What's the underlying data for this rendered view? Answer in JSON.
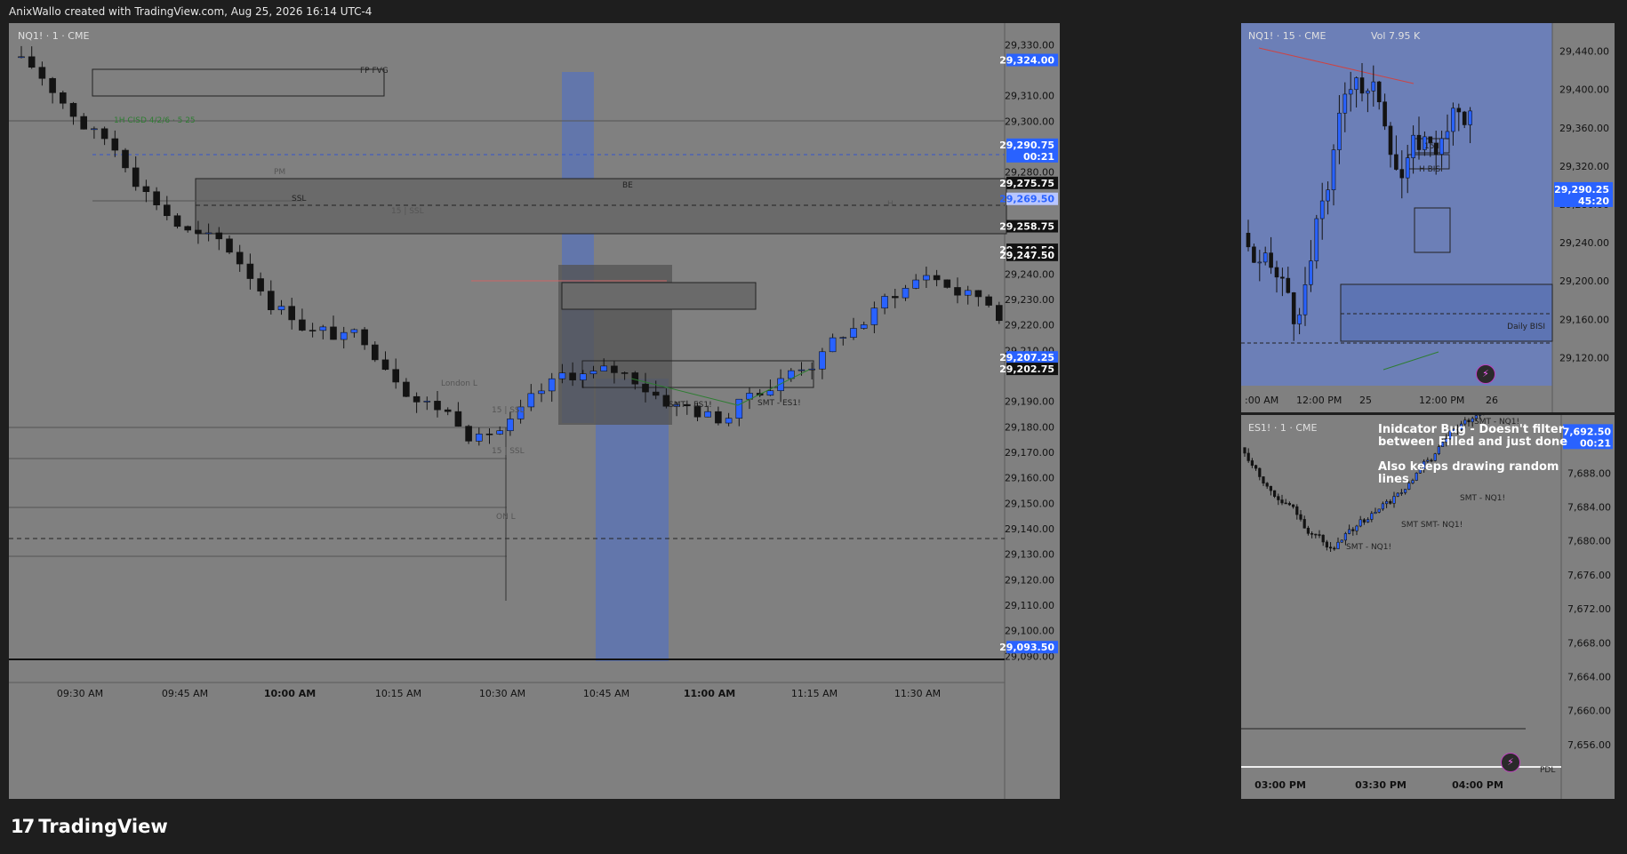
{
  "header": {
    "caption": "AnixWallo created with TradingView.com, Aug 25, 2026 16:14 UTC-4"
  },
  "footer": {
    "brand": "TradingView",
    "logo_mark": "17"
  },
  "colors": {
    "bg": "#1e1e1e",
    "pane_bg": "#808080",
    "bull": "#2962ff",
    "bear": "#131313",
    "zone": "#4a4a4a",
    "blue_zone": "#5d74b3"
  },
  "main_chart": {
    "symbol": "NQ1! · 1 · CME",
    "price_ticks": [
      "29,330.00",
      "29,310.00",
      "29,300.00",
      "29,280.00",
      "29,240.00",
      "29,230.00",
      "29,220.00",
      "29,210.00",
      "29,190.00",
      "29,180.00",
      "29,170.00",
      "29,160.00",
      "29,150.00",
      "29,140.00",
      "29,130.00",
      "29,120.00",
      "29,110.00",
      "29,100.00",
      "29,090.00"
    ],
    "price_badges": [
      {
        "text": "29,324.00",
        "style": "blue"
      },
      {
        "text": "29,290.75",
        "style": "blue"
      },
      {
        "text": "00:21",
        "style": "blue"
      },
      {
        "text": "29,275.75",
        "style": "dark"
      },
      {
        "text": "29,269.50",
        "style": "light"
      },
      {
        "text": "29,258.75",
        "style": "dark"
      },
      {
        "text": "29,249.50",
        "style": "dark"
      },
      {
        "text": "29,247.50",
        "style": "dark"
      },
      {
        "text": "29,207.25",
        "style": "blue"
      },
      {
        "text": "29,202.75",
        "style": "dark"
      },
      {
        "text": "29,093.50",
        "style": "blue"
      }
    ],
    "time_ticks": [
      {
        "text": "09:30 AM",
        "bold": false
      },
      {
        "text": "09:45 AM",
        "bold": false
      },
      {
        "text": "10:00 AM",
        "bold": true
      },
      {
        "text": "10:15 AM",
        "bold": false
      },
      {
        "text": "10:30 AM",
        "bold": false
      },
      {
        "text": "10:45 AM",
        "bold": false
      },
      {
        "text": "11:00 AM",
        "bold": true
      },
      {
        "text": "11:15 AM",
        "bold": false
      },
      {
        "text": "11:30 AM",
        "bold": false
      }
    ],
    "labels": {
      "fp_fvg": "FP FVG",
      "be": "BE",
      "ssl": "SSL",
      "ssl_15": "15 | SSL",
      "ssl_15_a": "15 | SSL",
      "ssl_15_b": "15 | SSL",
      "london_l": "London L",
      "on_l": "ON L",
      "smt_1": "SMT - ES1!",
      "smt_2": "SMT - ES1!",
      "green_label": "1H CISD 4/2/6 · 5 25",
      "pm": "PM",
      "h_mark": "H"
    }
  },
  "right_top_chart": {
    "symbol": "NQ1! · 15 · CME",
    "vol_label": "Vol 7.95 K",
    "price_ticks": [
      "29,440.00",
      "29,400.00",
      "29,360.00",
      "29,320.00",
      "29,280.00",
      "29,240.00",
      "29,200.00",
      "29,160.00",
      "29,120.00"
    ],
    "price_badge": "29,290.25",
    "timer": "45:20",
    "time_ticks": [
      ":00 AM",
      "12:00 PM",
      "25",
      "12:00 PM",
      "26"
    ],
    "labels": {
      "daily_bisi": "Daily BISI",
      "h_bisi": "H BISI",
      "fifteen": "15 I"
    }
  },
  "right_bottom_chart": {
    "symbol": "ES1! · 1 · CME",
    "price_ticks": [
      "7,688.00",
      "7,684.00",
      "7,680.00",
      "7,676.00",
      "7,672.00",
      "7,668.00",
      "7,664.00",
      "7,660.00",
      "7,656.00"
    ],
    "price_badge": "7,692.50",
    "timer": "00:21",
    "time_ticks": [
      "03:00 PM",
      "03:30 PM",
      "04:00 PM"
    ],
    "labels": {
      "smt_a": "SMT - NQ1!",
      "smt_b": "SMT - NQ1!",
      "smt_c": "SMT SMT- NQ1!",
      "smt_d": "SMT - NQ1!",
      "pdl": "PDL"
    },
    "note_lines": [
      "Inidcator Bug - Doesn't filter",
      "between Filled and just done",
      "",
      "Also keeps drawing random",
      "lines"
    ]
  }
}
